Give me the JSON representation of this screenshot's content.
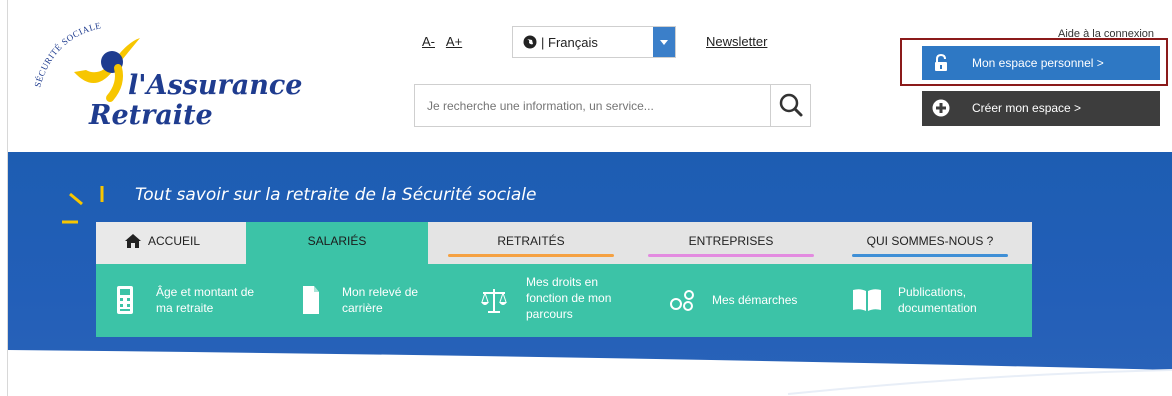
{
  "header": {
    "logo_arc_text": "SÉCURITÉ SOCIALE",
    "logo_line1": "l'Assurance",
    "logo_line2": "Retraite",
    "font_decrease": "A-",
    "font_increase": "A+",
    "language_selected": "Français",
    "newsletter": "Newsletter",
    "search_placeholder": "Je recherche une information, un service...",
    "help_link": "Aide à la connexion",
    "btn_espace": "Mon espace personnel >",
    "btn_creer": "Créer mon espace >"
  },
  "banner": {
    "tagline": "Tout savoir sur la retraite de la Sécurité sociale"
  },
  "tabs": [
    {
      "label": "ACCUEIL"
    },
    {
      "label": "SALARIÉS"
    },
    {
      "label": "RETRAITÉS",
      "underline": "#f5a142"
    },
    {
      "label": "ENTREPRISES",
      "underline": "#e38be0"
    },
    {
      "label": "QUI SOMMES-NOUS ?",
      "underline": "#3f8fd6"
    }
  ],
  "subnav": [
    {
      "icon": "calculator-icon",
      "line1": "Âge et montant de",
      "line2": "ma retraite"
    },
    {
      "icon": "document-icon",
      "line1": "Mon relevé de",
      "line2": "carrière"
    },
    {
      "icon": "scales-icon",
      "line1": "Mes droits en",
      "line2": "fonction de mon",
      "line3": "parcours"
    },
    {
      "icon": "steps-icon",
      "line1": "Mes démarches"
    },
    {
      "icon": "book-icon",
      "line1": "Publications,",
      "line2": "documentation"
    }
  ],
  "colors": {
    "brand_blue": "#1f3c8f",
    "banner_blue": "#1d5db2",
    "teal": "#3cc3a7",
    "button_blue": "#2e78c4",
    "button_dark": "#3d3d3d",
    "highlight_red": "#8b1a1a",
    "logo_yellow": "#f7c600"
  }
}
